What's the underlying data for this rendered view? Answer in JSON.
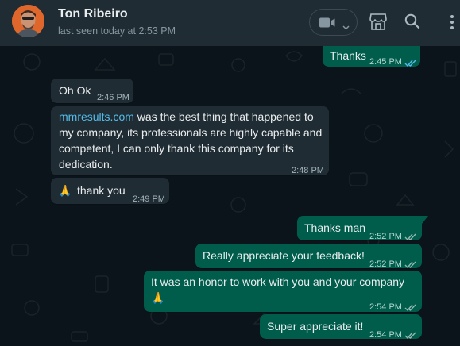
{
  "header": {
    "contact_name": "Ton Ribeiro",
    "last_seen": "last seen today at 2:53 PM",
    "icons": [
      "video-call-icon",
      "chevron-down-icon",
      "shop-icon",
      "search-icon",
      "menu-icon"
    ]
  },
  "colors": {
    "header_bg": "#202c33",
    "chat_bg": "#0b141a",
    "incoming_bubble": "#202c33",
    "outgoing_bubble": "#005c4b",
    "link": "#53bdeb",
    "read_ticks": "#53bdeb"
  },
  "messages": [
    {
      "direction": "out",
      "text": "Thanks",
      "time": "2:45 PM",
      "status": "read"
    },
    {
      "direction": "in",
      "text": "Oh Ok",
      "time": "2:46 PM"
    },
    {
      "direction": "in",
      "link": "mmresults.com",
      "text": " was the best thing that happened to my company, its professionals are highly capable and competent, I can only thank this company for its dedication.",
      "time": "2:48 PM"
    },
    {
      "direction": "in",
      "emoji": "🙏",
      "text": "thank you",
      "time": "2:49 PM"
    },
    {
      "direction": "out",
      "text": "Thanks man",
      "time": "2:52 PM",
      "status": "delivered"
    },
    {
      "direction": "out",
      "text": "Really appreciate your feedback!",
      "time": "2:52 PM",
      "status": "delivered"
    },
    {
      "direction": "out",
      "text": "It was an honor to work with you and your company",
      "emoji": "🙏",
      "time": "2:54 PM",
      "status": "delivered"
    },
    {
      "direction": "out",
      "text": "Super appreciate it!",
      "time": "2:54 PM",
      "status": "delivered"
    }
  ]
}
